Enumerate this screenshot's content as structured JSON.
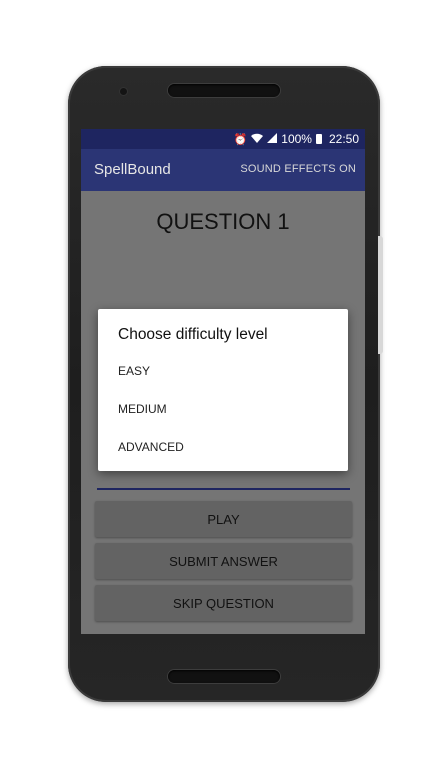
{
  "status_bar": {
    "alarm_icon": "alarm-icon",
    "wifi_icon": "wifi-icon",
    "signal_icon": "signal-icon",
    "battery_percent": "100%",
    "battery_icon": "battery-icon",
    "time": "22:50"
  },
  "app_bar": {
    "title": "SpellBound",
    "sound_effects": "SOUND EFFECTS ON"
  },
  "main": {
    "question_title": "QUESTION 1",
    "buttons": [
      {
        "label": "PLAY"
      },
      {
        "label": "SUBMIT ANSWER"
      },
      {
        "label": "SKIP QUESTION"
      }
    ]
  },
  "dialog": {
    "title": "Choose difficulty level",
    "options": [
      {
        "label": "EASY"
      },
      {
        "label": "MEDIUM"
      },
      {
        "label": "ADVANCED"
      }
    ]
  },
  "colors": {
    "app_bar": "#2b3575",
    "status_bar": "#1e2560",
    "scrim": "#757575",
    "dialog_bg": "#ffffff"
  }
}
